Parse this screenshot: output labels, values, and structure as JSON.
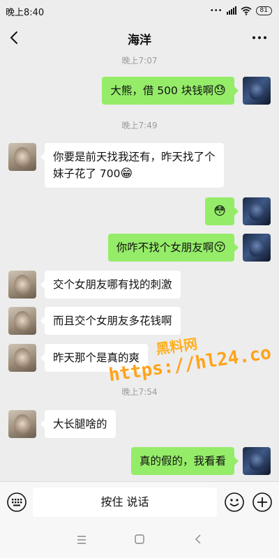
{
  "status_bar": {
    "time": "晚上8:40",
    "dots": "•••",
    "battery": "81"
  },
  "header": {
    "title": "海洋"
  },
  "messages": [
    {
      "type": "time",
      "text": "晚上7:07"
    },
    {
      "type": "msg",
      "from": "self",
      "text": "大熊，借 500 块钱啊",
      "emoji": "😓"
    },
    {
      "type": "time",
      "text": "晚上7:49"
    },
    {
      "type": "msg",
      "from": "other",
      "line1": "你要是前天找我还有，昨天找了个",
      "line2": "妹子花了 700",
      "emoji": "😁"
    },
    {
      "type": "msg",
      "from": "self",
      "text": "",
      "emoji": "😳"
    },
    {
      "type": "msg",
      "from": "self",
      "text": "你咋不找个女朋友啊",
      "emoji": "😚"
    },
    {
      "type": "msg",
      "from": "other",
      "text": "交个女朋友哪有找的刺激"
    },
    {
      "type": "msg",
      "from": "other",
      "text": "而且交个女朋友多花钱啊"
    },
    {
      "type": "msg",
      "from": "other",
      "text": "昨天那个是真的爽"
    },
    {
      "type": "time",
      "text": "晚上7:54"
    },
    {
      "type": "msg",
      "from": "other",
      "text": "大长腿啥的"
    },
    {
      "type": "msg",
      "from": "self",
      "text": "真的假的，我看看"
    }
  ],
  "watermark": {
    "line1": "黑料网",
    "line2": "https://hl24.co"
  },
  "input_bar": {
    "hold_to_talk": "按住 说话"
  },
  "colors": {
    "background": "#ededed",
    "self_bubble": "#95ec69",
    "other_bubble": "#ffffff",
    "watermark": "#ffa31a"
  }
}
